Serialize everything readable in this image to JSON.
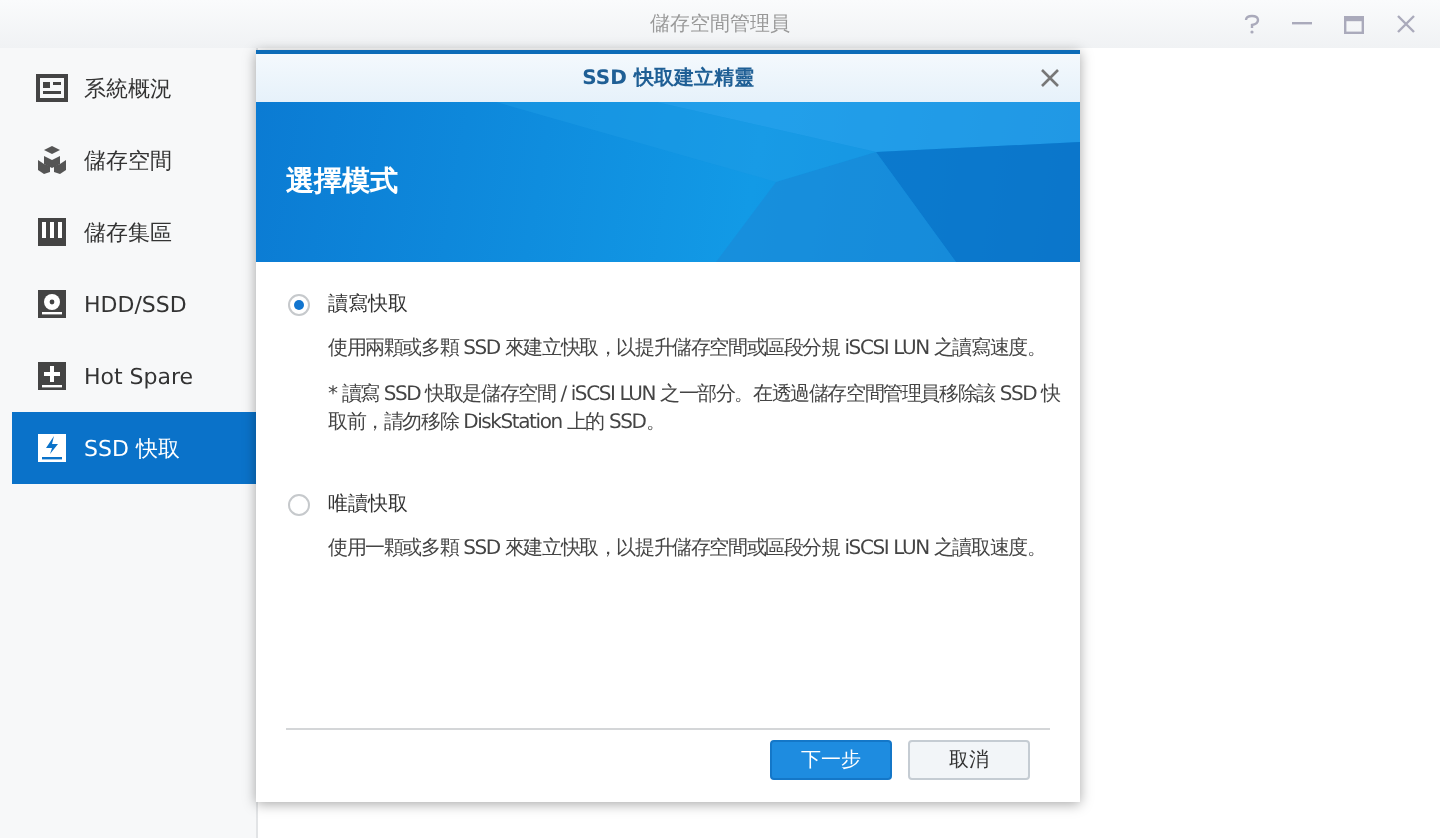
{
  "window": {
    "title": "儲存空間管理員",
    "controls": [
      {
        "kind": "help"
      },
      {
        "kind": "minimize"
      },
      {
        "kind": "maximize"
      },
      {
        "kind": "close"
      }
    ]
  },
  "sidebar": {
    "items": [
      {
        "label": "系統概況",
        "kind": "overview",
        "selected": false
      },
      {
        "label": "儲存空間",
        "kind": "volume",
        "selected": false
      },
      {
        "label": "儲存集區",
        "kind": "pool",
        "selected": false
      },
      {
        "label": "HDD/SSD",
        "kind": "disk",
        "selected": false
      },
      {
        "label": "Hot Spare",
        "kind": "spare",
        "selected": false
      },
      {
        "label": "SSD 快取",
        "kind": "cache",
        "selected": true
      }
    ]
  },
  "dialog": {
    "title": "SSD 快取建立精靈",
    "heading": "選擇模式",
    "options": [
      {
        "label": "讀寫快取",
        "selected": true,
        "description": "使用兩顆或多顆 SSD 來建立快取，以提升儲存空間或區段分規 iSCSI LUN 之讀寫速度。",
        "note": "* 讀寫 SSD 快取是儲存空間 / iSCSI LUN 之一部分。在透過儲存空間管理員移除該 SSD 快取前，請勿移除 DiskStation 上的 SSD。"
      },
      {
        "label": "唯讀快取",
        "selected": false,
        "description": "使用一顆或多顆 SSD 來建立快取，以提升儲存空間或區段分規 iSCSI LUN 之讀取速度。"
      }
    ],
    "buttons": [
      {
        "label": "下一步",
        "kind": "primary"
      },
      {
        "label": "取消",
        "kind": "secondary"
      }
    ]
  }
}
